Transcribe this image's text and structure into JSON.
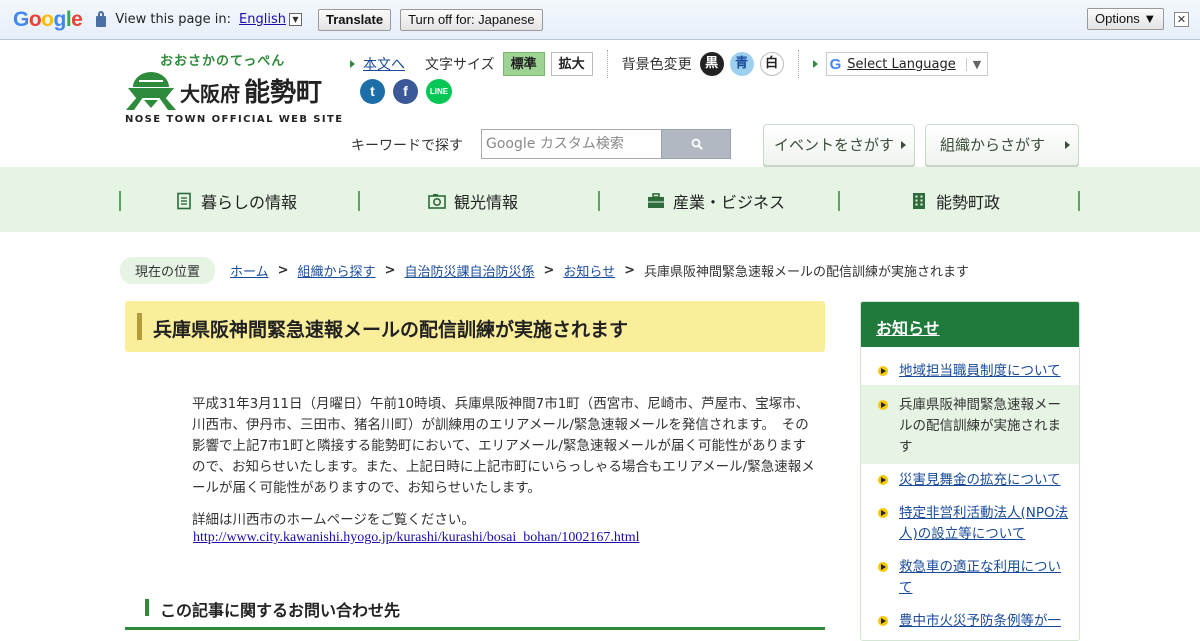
{
  "translate_bar": {
    "view_text": "View this page in:",
    "language": "English",
    "translate_label": "Translate",
    "turn_off_label": "Turn off for: Japanese",
    "options_label": "Options ▼",
    "close_label": "✕"
  },
  "header": {
    "logo_kana": "おおさかのてっぺん",
    "logo_osaka": "大阪府",
    "logo_nose": "能勢町",
    "logo_en": "NOSE TOWN OFFICIAL WEB SITE",
    "skip_link": "本文へ",
    "font_size_label": "文字サイズ",
    "font_standard": "標準",
    "font_large": "拡大",
    "bg_label": "背景色変更",
    "bg_black": "黒",
    "bg_blue": "青",
    "bg_white": "白",
    "select_language": "Select Language",
    "select_language_caret": "▼",
    "search_label": "キーワードで探す",
    "search_placeholder": "Google カスタム検索",
    "event_button": "イベントをさがす",
    "org_button": "組織からさがす",
    "sns": {
      "twitter": "t",
      "facebook": "f",
      "line": "LINE"
    }
  },
  "global_nav": [
    {
      "label": "暮らしの情報",
      "icon": "document-list-icon"
    },
    {
      "label": "観光情報",
      "icon": "camera-icon"
    },
    {
      "label": "産業・ビジネス",
      "icon": "briefcase-icon"
    },
    {
      "label": "能勢町政",
      "icon": "building-icon"
    }
  ],
  "breadcrumb": {
    "here_label": "現在の位置",
    "items": [
      "ホーム",
      "組織から探す",
      "自治防災課自治防災係",
      "お知らせ"
    ],
    "current": "兵庫県阪神間緊急速報メールの配信訓練が実施されます",
    "separator": ">"
  },
  "article": {
    "title": "兵庫県阪神間緊急速報メールの配信訓練が実施されます",
    "body": "平成31年3月11日（月曜日）午前10時頃、兵庫県阪神間7市1町（西宮市、尼崎市、芦屋市、宝塚市、川西市、伊丹市、三田市、猪名川町）が訓練用のエリアメール/緊急速報メールを発信されます。　その影響で上記7市1町と隣接する能勢町において、エリアメール/緊急速報メールが届く可能性がありますので、お知らせいたします。また、上記日時に上記市町にいらっしゃる場合もエリアメール/緊急速報メールが届く可能性がありますので、お知らせいたします。",
    "detail": "詳細は川西市のホームページをご覧ください。",
    "link": "http://www.city.kawanishi.hyogo.jp/kurashi/kurashi/bosai_bohan/1002167.html",
    "contact_heading": "この記事に関するお問い合わせ先"
  },
  "sidebar": {
    "heading": "お知らせ",
    "items": [
      "地域担当職員制度について",
      "兵庫県阪神間緊急速報メールの配信訓練が実施されます",
      "災害見舞金の拡充について",
      "特定非営利活動法人(NPO法人)の設立等について",
      "救急車の適正な利用について",
      "豊中市火災予防条例等が一"
    ]
  }
}
